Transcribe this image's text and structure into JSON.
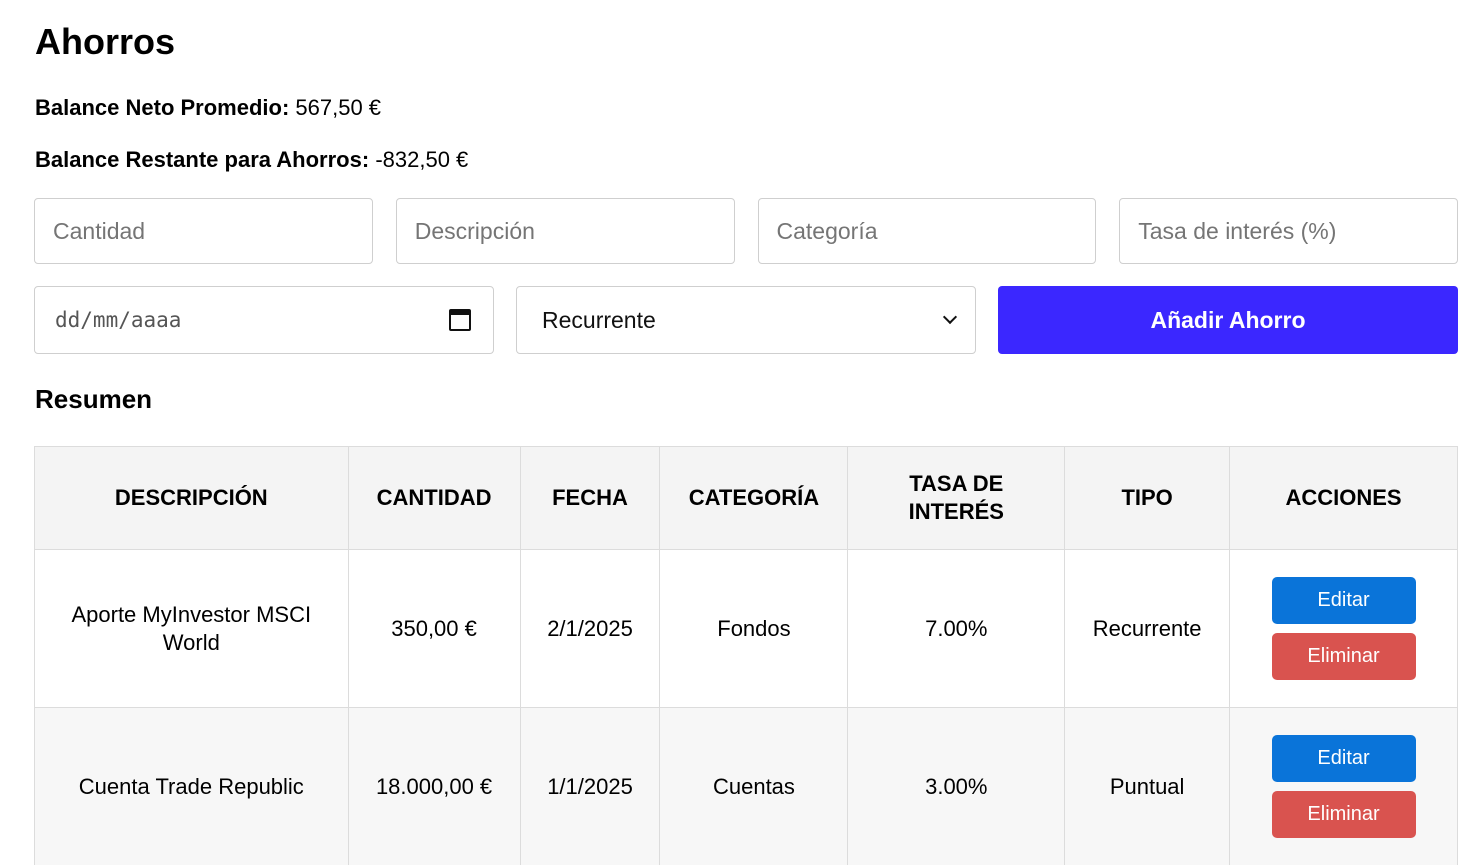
{
  "page": {
    "title": "Ahorros",
    "balances": [
      {
        "label": "Balance Neto Promedio:",
        "value": "567,50 €"
      },
      {
        "label": "Balance Restante para Ahorros:",
        "value": "-832,50 €"
      }
    ]
  },
  "form": {
    "amount_placeholder": "Cantidad",
    "description_placeholder": "Descripción",
    "category_placeholder": "Categoría",
    "rate_placeholder": "Tasa de interés (%)",
    "date_placeholder": "dd/mm/aaaa",
    "type_selected": "Recurrente",
    "submit_label": "Añadir Ahorro"
  },
  "summary": {
    "heading": "Resumen",
    "columns": [
      "DESCRIPCIÓN",
      "CANTIDAD",
      "FECHA",
      "CATEGORÍA",
      "TASA DE INTERÉS",
      "TIPO",
      "ACCIONES"
    ],
    "rows": [
      {
        "description": "Aporte MyInvestor MSCI World",
        "amount": "350,00 €",
        "date": "2/1/2025",
        "category": "Fondos",
        "rate": "7.00%",
        "type": "Recurrente",
        "edit_label": "Editar",
        "delete_label": "Eliminar"
      },
      {
        "description": "Cuenta Trade Republic",
        "amount": "18.000,00 €",
        "date": "1/1/2025",
        "category": "Cuentas",
        "rate": "3.00%",
        "type": "Puntual",
        "edit_label": "Editar",
        "delete_label": "Eliminar"
      }
    ]
  },
  "colors": {
    "primary_button": "#3b27ff",
    "edit_button": "#0a74d9",
    "delete_button": "#d9534f"
  }
}
